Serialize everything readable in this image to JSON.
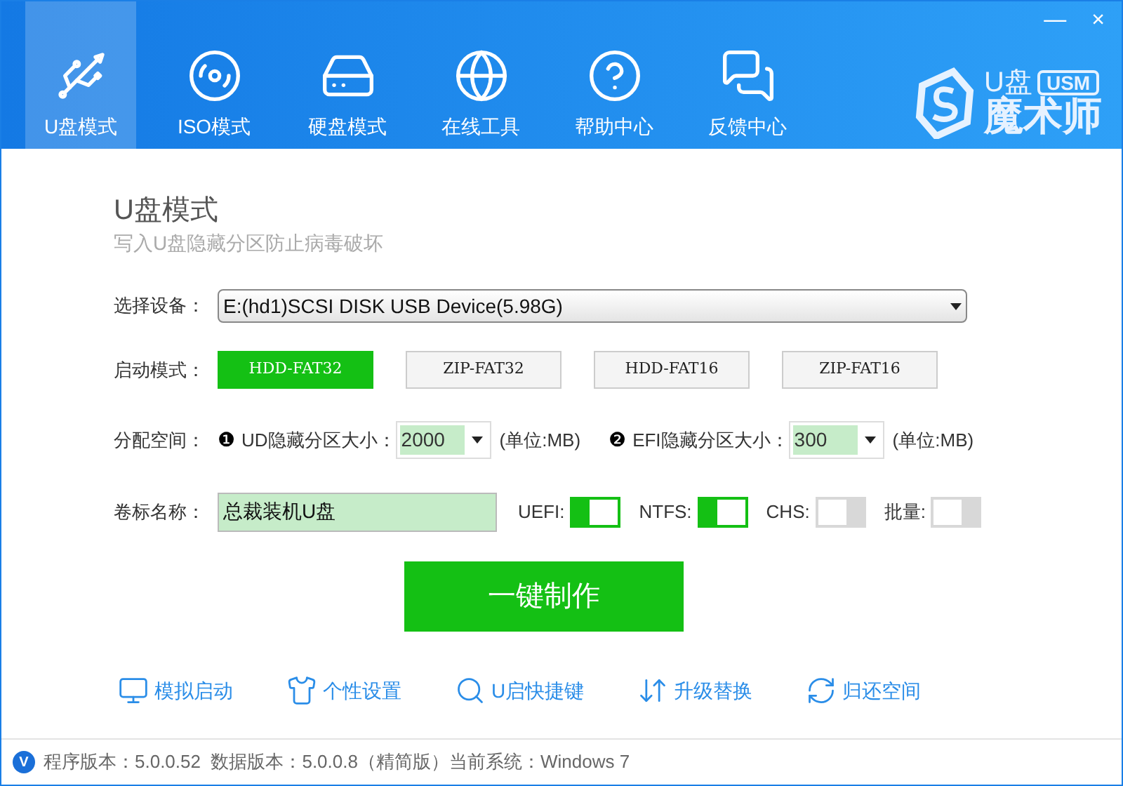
{
  "window": {
    "close": "×",
    "minimize": "—"
  },
  "tabs": [
    {
      "label": "U盘模式",
      "kind": "usb",
      "selected": true
    },
    {
      "label": "ISO模式",
      "kind": "disc",
      "selected": false
    },
    {
      "label": "硬盘模式",
      "kind": "hdd",
      "selected": false
    },
    {
      "label": "在线工具",
      "kind": "globe",
      "selected": false
    },
    {
      "label": "帮助中心",
      "kind": "help",
      "selected": false
    },
    {
      "label": "反馈中心",
      "kind": "chat",
      "selected": false
    }
  ],
  "logo": {
    "line1": "U盘",
    "badge": "USM",
    "line2": "魔术师"
  },
  "heading": {
    "title": "U盘模式",
    "subtitle": "写入U盘隐藏分区防止病毒破坏"
  },
  "device": {
    "label": "选择设备：",
    "value": "E:(hd1)SCSI DISK USB Device(5.98G)"
  },
  "boot_mode": {
    "label": "启动模式：",
    "options": [
      {
        "label": "HDD-FAT32",
        "selected": true
      },
      {
        "label": "ZIP-FAT32",
        "selected": false
      },
      {
        "label": "HDD-FAT16",
        "selected": false
      },
      {
        "label": "ZIP-FAT16",
        "selected": false
      }
    ]
  },
  "space": {
    "label": "分配空间：",
    "fields": [
      {
        "marker": "❶",
        "label": "UD隐藏分区大小：",
        "value": "2000",
        "unit": "(单位:MB)"
      },
      {
        "marker": "❷",
        "label": "EFI隐藏分区大小：",
        "value": "300",
        "unit": "(单位:MB)"
      }
    ]
  },
  "volume": {
    "label": "卷标名称：",
    "value": "总裁装机U盘",
    "toggles": [
      {
        "label": "UEFI:",
        "on": true
      },
      {
        "label": "NTFS:",
        "on": true
      },
      {
        "label": "CHS:",
        "on": false
      },
      {
        "label": "批量:",
        "on": false
      }
    ]
  },
  "action_button": "一键制作",
  "links": [
    {
      "label": "模拟启动",
      "kind": "monitor"
    },
    {
      "label": "个性设置",
      "kind": "shirt"
    },
    {
      "label": "U启快捷键",
      "kind": "search"
    },
    {
      "label": "升级替换",
      "kind": "updown"
    },
    {
      "label": "归还空间",
      "kind": "refresh"
    }
  ],
  "status_bar": {
    "badge": "V",
    "text": "程序版本：5.0.0.52  数据版本：5.0.0.8（精简版）当前系统：Windows 7"
  }
}
